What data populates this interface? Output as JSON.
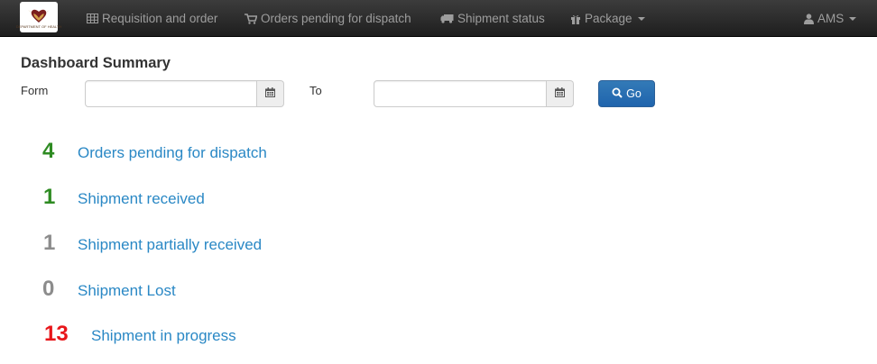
{
  "navbar": {
    "brand_caption": "DEPARTMENT OF HEALTH",
    "items": [
      {
        "label": "Requisition and order",
        "icon": "table-icon"
      },
      {
        "label": "Orders pending for dispatch",
        "icon": "cart-icon"
      },
      {
        "label": "Shipment status",
        "icon": "truck-icon"
      },
      {
        "label": "Package",
        "icon": "gift-icon",
        "dropdown": true
      }
    ],
    "user": {
      "label": "AMS",
      "icon": "user-icon",
      "dropdown": true
    }
  },
  "dashboard": {
    "title": "Dashboard Summary",
    "filter": {
      "from_label": "Form",
      "from_value": "",
      "to_label": "To",
      "to_value": "",
      "go_label": "Go"
    },
    "stats": [
      {
        "count": "4",
        "label": "Orders pending for dispatch",
        "color": "#2e8b22"
      },
      {
        "count": "1",
        "label": "Shipment received",
        "color": "#2e8b22"
      },
      {
        "count": "1",
        "label": "Shipment partially received",
        "color": "#8c8c8c"
      },
      {
        "count": "0",
        "label": "Shipment Lost",
        "color": "#8c8c8c"
      },
      {
        "count": "13",
        "label": "Shipment in progress",
        "color": "#e8161a"
      }
    ]
  },
  "colors": {
    "navbar_bg": "#222222",
    "nav_text": "#9d9d9d",
    "link": "#2a88c5",
    "primary_button": "#337ab7"
  }
}
